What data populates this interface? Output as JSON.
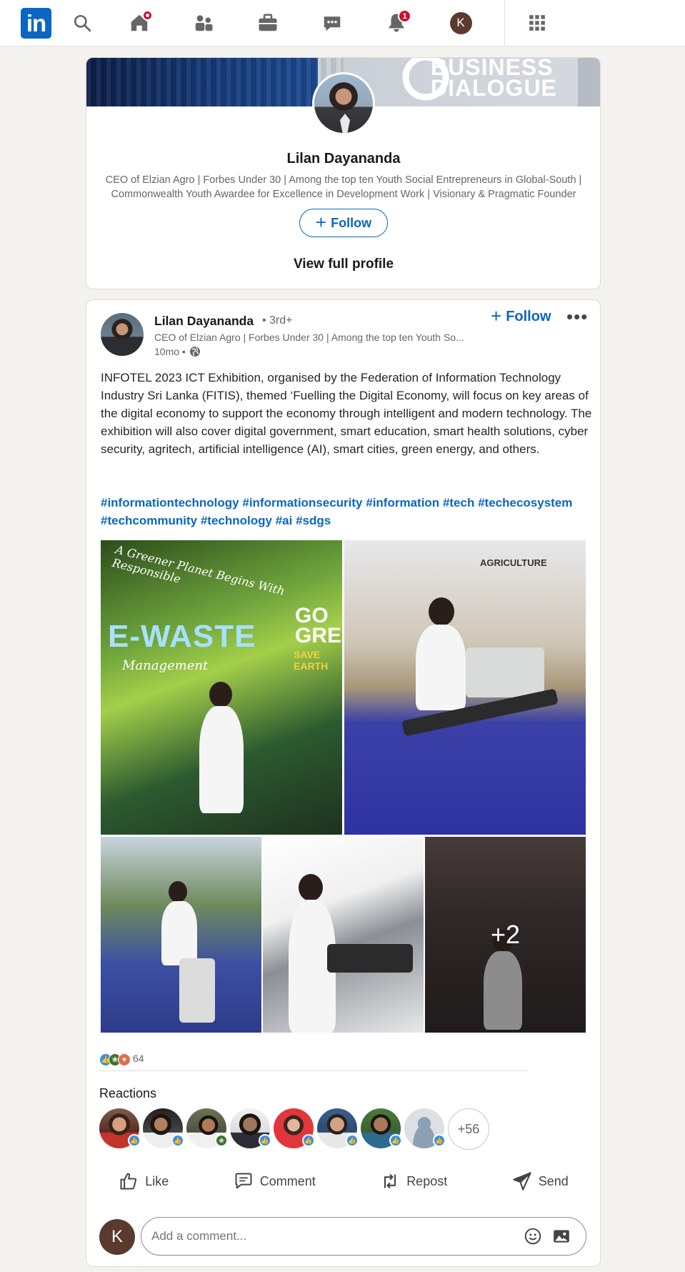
{
  "nav": {
    "logo": "in",
    "icons": [
      "search-icon",
      "home-icon",
      "people-icon",
      "jobs-briefcase-icon",
      "messaging-icon",
      "notifications-bell-icon",
      "me-avatar",
      "apps-grid-icon"
    ],
    "notifications_badge": "1",
    "me_initial": "K"
  },
  "profile_card": {
    "banner_line1": "BUSINESS",
    "banner_line2": "DIALOGUE",
    "name": "Lilan Dayananda",
    "headline": "CEO of Elzian Agro | Forbes Under 30 | Among the top ten Youth Social Entrepreneurs in Global-South | Commonwealth Youth Awardee for Excellence in Development Work | Visionary & Pragmatic Founder",
    "follow_label": "Follow",
    "view_profile_label": "View full profile"
  },
  "post": {
    "author": "Lilan Dayananda",
    "degree": "• 3rd+",
    "headline": "CEO of Elzian Agro | Forbes Under 30 | Among the top ten Youth So...",
    "time": "10mo •",
    "follow_label": "Follow",
    "more_label": "•••",
    "text": "INFOTEL 2023 ICT Exhibition, organised by the Federation of Information Technology Industry Sri Lanka (FITIS), themed ‘Fuelling the Digital Economy, will focus on key areas of the digital economy to support the economy through intelligent and modern technology. The exhibition will also cover digital government, smart education, smart health solutions, cyber security, agritech, artificial intelligence (AI), smart cities, green energy, and others.",
    "hashtags": [
      "#informationtechnology",
      "#informationsecurity",
      "#information",
      "#tech",
      "#techecosystem",
      "#techcommunity",
      "#technology",
      "#ai",
      "#sdgs"
    ],
    "photo_texts": {
      "p1_caption": "A Greener Planet Begins With Responsible",
      "p1_ewaste": "E-WASTE",
      "p1_management": "Management",
      "p1_go": "GO GREEN",
      "p1_save": "SAVE EARTH",
      "p2_agri": "AGRICULTURE"
    },
    "more_photos": "+2",
    "reaction_count": "64",
    "reactions_label": "Reactions",
    "more_reactors": "+56",
    "actions": {
      "like": "Like",
      "comment": "Comment",
      "repost": "Repost",
      "send": "Send"
    },
    "comment_placeholder": "Add a comment...",
    "me_initial": "K"
  },
  "colors": {
    "brand": "#0a66c2",
    "badge": "#cb112d",
    "background": "#f4f2ee"
  }
}
